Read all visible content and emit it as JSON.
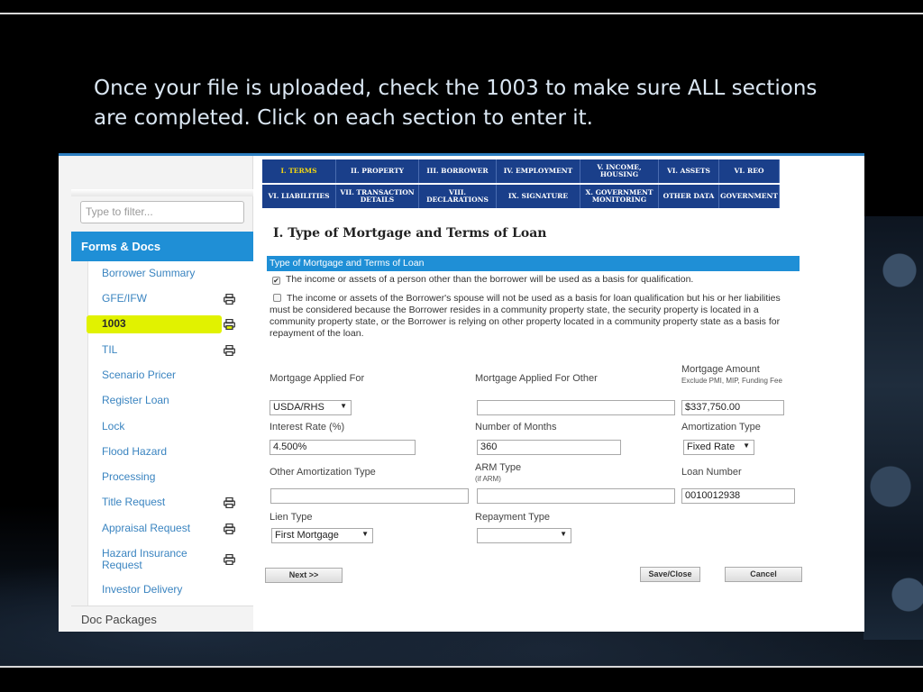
{
  "headline": "Once your file is uploaded, check the 1003 to make sure ALL sections are completed.  Click on each section to enter it.",
  "sidebar": {
    "filter_placeholder": "Type to filter...",
    "forms_header": "Forms & Docs",
    "items": [
      {
        "label": "Borrower Summary",
        "print": false
      },
      {
        "label": "GFE/IFW",
        "print": true
      },
      {
        "label": "1003",
        "print": true,
        "active": true
      },
      {
        "label": "TIL",
        "print": true
      },
      {
        "label": "Scenario Pricer",
        "print": false
      },
      {
        "label": "Register Loan",
        "print": false
      },
      {
        "label": "Lock",
        "print": false
      },
      {
        "label": "Flood Hazard",
        "print": false
      },
      {
        "label": "Processing",
        "print": false
      },
      {
        "label": "Title Request",
        "print": true
      },
      {
        "label": "Appraisal Request",
        "print": true
      },
      {
        "label": "Hazard Insurance Request",
        "print": true
      },
      {
        "label": "Investor Delivery",
        "print": false
      }
    ],
    "doc_packages": "Doc Packages",
    "highlight_color": "#e1f200"
  },
  "tabs": {
    "row1": [
      "I. TERMS",
      "II. PROPERTY",
      "III. BORROWER",
      "IV. EMPLOYMENT",
      "V. INCOME, HOUSING",
      "VI. ASSETS",
      "VI. REO"
    ],
    "row2": [
      "VI. LIABILITIES",
      "VII. TRANSACTION DETAILS",
      "VIII. DECLARATIONS",
      "IX. SIGNATURE",
      "X. GOVERNMENT MONITORING",
      "OTHER DATA",
      "GOVERNMENT"
    ],
    "active": "I. TERMS",
    "tab_color": "#1a3f8a",
    "active_color": "#f5d80f"
  },
  "form": {
    "section_title": "I. Type of Mortgage and Terms of Loan",
    "bar_title": "Type of Mortgage and Terms of Loan",
    "checkbox1": {
      "checked": true,
      "text": "The income or assets of a person other than the borrower will be used as a basis for qualification."
    },
    "checkbox2": {
      "checked": false,
      "text": "The income or assets of the Borrower's spouse will not be used as a basis for loan qualification but his or her liabilities must be considered because the Borrower resides in a community property state, the security property is located in a community property state, or the Borrower is relying on other property located in a community property state as a basis for repayment of the loan."
    },
    "mortgage_applied_for": {
      "label": "Mortgage Applied For",
      "value": "USDA/RHS"
    },
    "mortgage_applied_other": {
      "label": "Mortgage Applied For Other",
      "value": ""
    },
    "mortgage_amount": {
      "label": "Mortgage Amount",
      "sub": "Exclude PMI, MIP, Funding Fee",
      "value": "$337,750.00"
    },
    "interest_rate": {
      "label": "Interest Rate (%)",
      "value": "4.500%"
    },
    "number_of_months": {
      "label": "Number of Months",
      "value": "360"
    },
    "amortization_type": {
      "label": "Amortization Type",
      "value": "Fixed Rate"
    },
    "other_amortization": {
      "label": "Other Amortization Type",
      "value": ""
    },
    "arm_type": {
      "label": "ARM Type",
      "sub": "(if ARM)",
      "value": ""
    },
    "loan_number": {
      "label": "Loan Number",
      "value": "0010012938"
    },
    "lien_type": {
      "label": "Lien Type",
      "value": "First Mortgage"
    },
    "repayment_type": {
      "label": "Repayment Type",
      "value": ""
    },
    "buttons": {
      "next": "Next >>",
      "save_close": "Save/Close",
      "cancel": "Cancel"
    },
    "bar_color": "#1f8fd6"
  }
}
